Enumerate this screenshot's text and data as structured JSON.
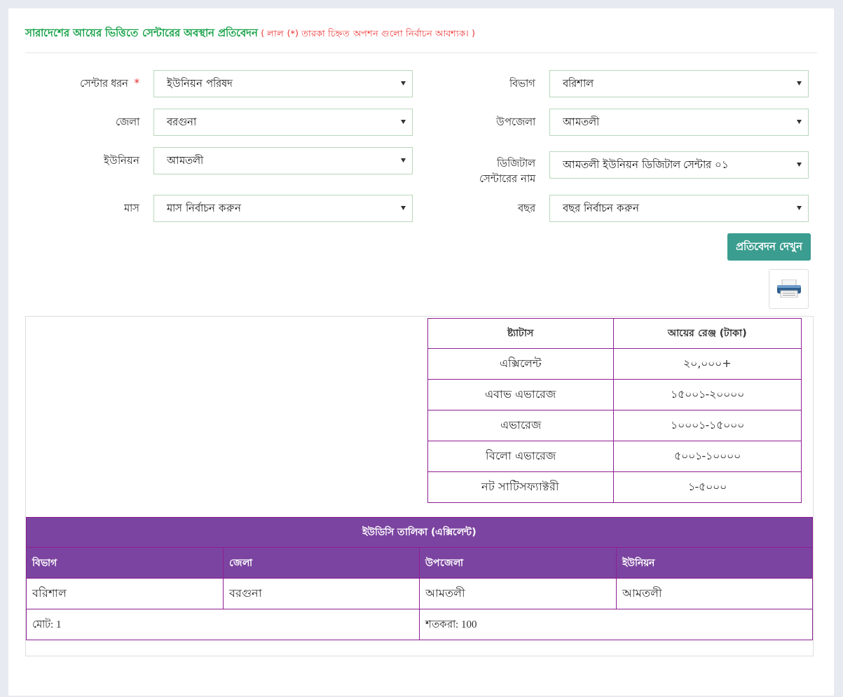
{
  "title": {
    "main": "সারাদেশের আয়ের ভিত্তিতে সেন্টারের অবস্থান প্রতিবেদন",
    "note": "( লাল (*) তারকা চিহ্নত অপশন গুলো নির্বাচন আবশ্যক। )"
  },
  "fields": [
    {
      "label": "সেন্টার ধরন",
      "required": true,
      "value": "ইউনিয়ন পরিষদ"
    },
    {
      "label": "বিভাগ",
      "required": false,
      "value": "বরিশাল"
    },
    {
      "label": "জেলা",
      "required": false,
      "value": "বরগুনা"
    },
    {
      "label": "উপজেলা",
      "required": false,
      "value": "আমতলী"
    },
    {
      "label": "ইউনিয়ন",
      "required": false,
      "value": "আমতলী"
    },
    {
      "label": "ডিজিটাল সেন্টারের নাম",
      "required": false,
      "value": "আমতলী ইউনিয়ন ডিজিটাল সেন্টার ০১"
    },
    {
      "label": "মাস",
      "required": false,
      "value": "মাস নির্বাচন করুন"
    },
    {
      "label": "বছর",
      "required": false,
      "value": "বছর নির্বাচন করুন"
    }
  ],
  "required_mark": "*",
  "submit_button": "প্রতিবেদন দেখুন",
  "legend_table": {
    "columns": [
      "ষ্ট্যাটাস",
      "আয়ের রেঞ্জ (টাকা)"
    ],
    "rows": [
      [
        "এক্সিলেন্ট",
        "২০,০০০+"
      ],
      [
        "এবাভ এভারেজ",
        "১৫০০১-২০০০০"
      ],
      [
        "এভারেজ",
        "১০০০১-১৫০০০"
      ],
      [
        "বিলো এভারেজ",
        "৫০০১-১০০০০"
      ],
      [
        "নট সাটিসফ্যাক্টরী",
        "১-৫০০০"
      ]
    ]
  },
  "udc_table": {
    "caption": "ইউডিসি তালিকা (এক্সিলেন্ট)",
    "columns": [
      "বিভাগ",
      "জেলা",
      "উপজেলা",
      "ইউনিয়ন"
    ],
    "rows": [
      [
        "বরিশাল",
        "বরগুনা",
        "আমতলী",
        "আমতলী"
      ]
    ],
    "footer": [
      "মোট: 1",
      "শতকরা: 100"
    ]
  }
}
